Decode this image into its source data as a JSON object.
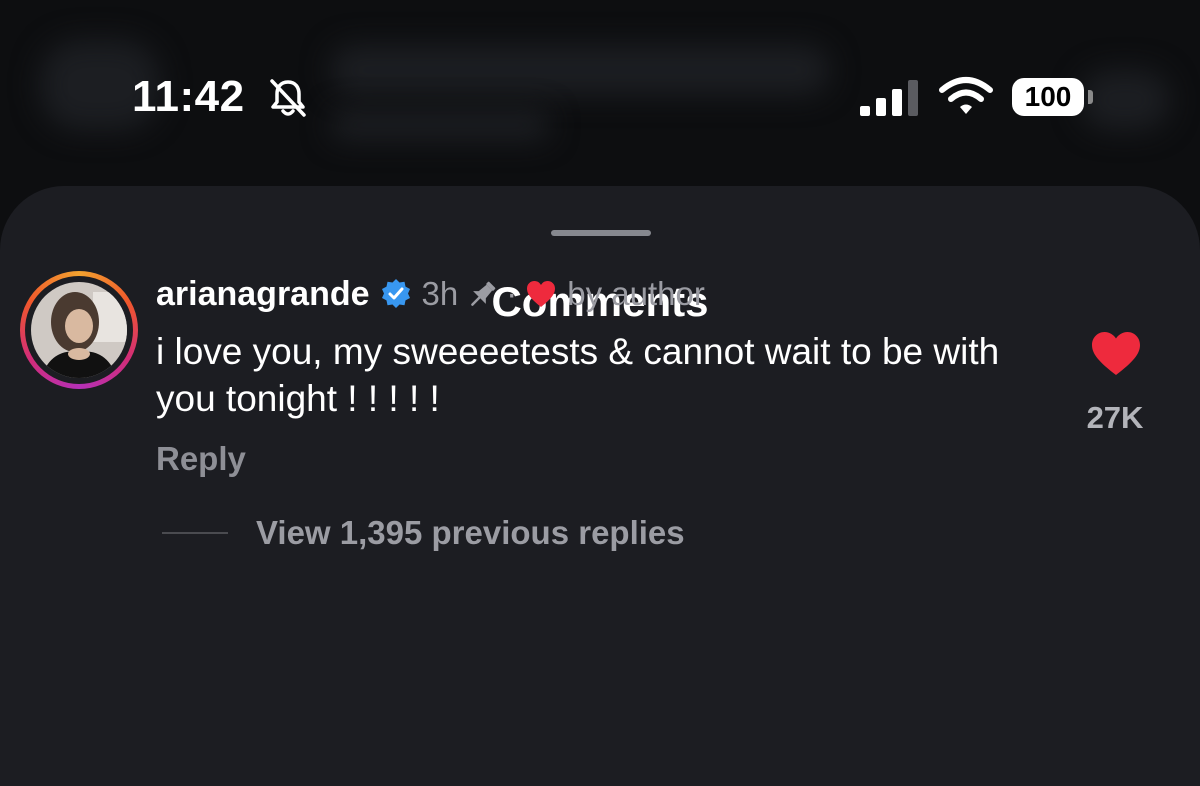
{
  "status_bar": {
    "time": "11:42",
    "battery": "100",
    "icons": [
      "bell-slash-icon",
      "cellular-signal-icon",
      "wifi-icon",
      "battery-icon"
    ]
  },
  "sheet": {
    "title": "Comments"
  },
  "comment": {
    "username": "arianagrande",
    "time_ago": "3h",
    "separator": "·",
    "liked_by": "by author",
    "text": "i love you, my sweeeetests & cannot wait to be with you tonight ! ! ! ! !",
    "reply_label": "Reply",
    "like_count": "27K",
    "view_replies": "View 1,395 previous replies",
    "icons": [
      "verified-badge-icon",
      "pin-icon",
      "heart-icon"
    ]
  },
  "colors": {
    "background": "#0d0e10",
    "sheet": "#1c1d22",
    "heart": "#ee2a3d",
    "verified": "#3897f0",
    "muted_text": "#9b9ca3"
  }
}
